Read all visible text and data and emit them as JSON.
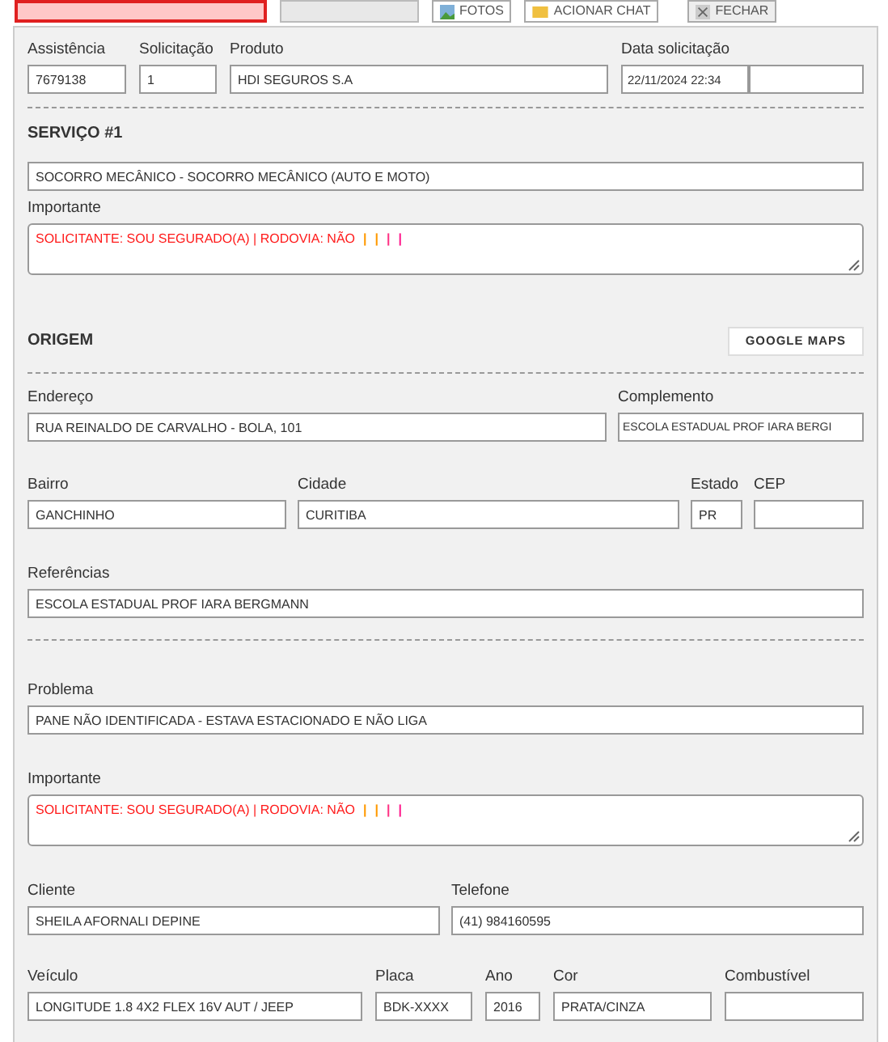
{
  "toolbar": {
    "buttons": [
      {
        "kind": "alert"
      },
      {
        "kind": "plain"
      },
      {
        "kind": "photo",
        "label": "FOTOS"
      },
      {
        "kind": "chat",
        "label": "ACIONAR CHAT"
      },
      {
        "kind": "close",
        "label": "FECHAR"
      }
    ]
  },
  "header": {
    "fields": [
      {
        "label": "Assistência",
        "value": "7679138"
      },
      {
        "label": "Solicitação",
        "value": "1"
      },
      {
        "label": "Produto",
        "value": "HDI SEGUROS S.A"
      },
      {
        "label": "Data solicitação",
        "value": "22/11/2024 22:34"
      }
    ]
  },
  "service": {
    "title": "SERVIÇO #1",
    "value": "SOCORRO MECÂNICO - SOCORRO MECÂNICO (AUTO E MOTO)",
    "important_label": "Importante",
    "important": [
      {
        "text": "SOLICITANTE: SOU SEGURADO(A) | RODOVIA: NÃO",
        "color": "#ff1a1a"
      },
      {
        "text": "|",
        "color": "#ff9900"
      },
      {
        "text": "|",
        "color": "#ff9900"
      },
      {
        "text": "|",
        "color": "#ff3385"
      },
      {
        "text": "|",
        "color": "#ff1a8c"
      }
    ]
  },
  "origin": {
    "title": "ORIGEM",
    "maps_button": "GOOGLE MAPS",
    "address": {
      "label": "Endereço",
      "value": "RUA REINALDO DE CARVALHO - BOLA, 101"
    },
    "complement": {
      "label": "Complemento",
      "value": "ESCOLA ESTADUAL PROF IARA BERGI"
    },
    "district": {
      "label": "Bairro",
      "value": "GANCHINHO"
    },
    "city": {
      "label": "Cidade",
      "value": "CURITIBA"
    },
    "state": {
      "label": "Estado",
      "value": "PR"
    },
    "zip": {
      "label": "CEP"
    },
    "references": {
      "label": "Referências",
      "value": "ESCOLA ESTADUAL PROF IARA BERGMANN"
    }
  },
  "problem": {
    "label": "Problema",
    "value": "PANE NÃO IDENTIFICADA - ESTAVA ESTACIONADO E NÃO LIGA",
    "important_label": "Importante",
    "important": [
      {
        "text": "SOLICITANTE: SOU SEGURADO(A) | RODOVIA: NÃO",
        "color": "#ff1a1a"
      },
      {
        "text": "|",
        "color": "#ff9900"
      },
      {
        "text": "|",
        "color": "#ff9900"
      },
      {
        "text": "|",
        "color": "#ff3385"
      },
      {
        "text": "|",
        "color": "#ff1a8c"
      }
    ]
  },
  "client": {
    "name": {
      "label": "Cliente",
      "value": "SHEILA AFORNALI DEPINE"
    },
    "phone": {
      "label": "Telefone",
      "value": "(41) 984160595"
    }
  },
  "vehicle": [
    {
      "label": "Veículo",
      "value": "LONGITUDE 1.8 4X2 FLEX 16V AUT / JEEP"
    },
    {
      "label": "Placa",
      "value": "BDK-XXXX"
    },
    {
      "label": "Ano",
      "value": "2016"
    },
    {
      "label": "Cor",
      "value": "PRATA/CINZA"
    },
    {
      "label": "Combustível"
    }
  ]
}
